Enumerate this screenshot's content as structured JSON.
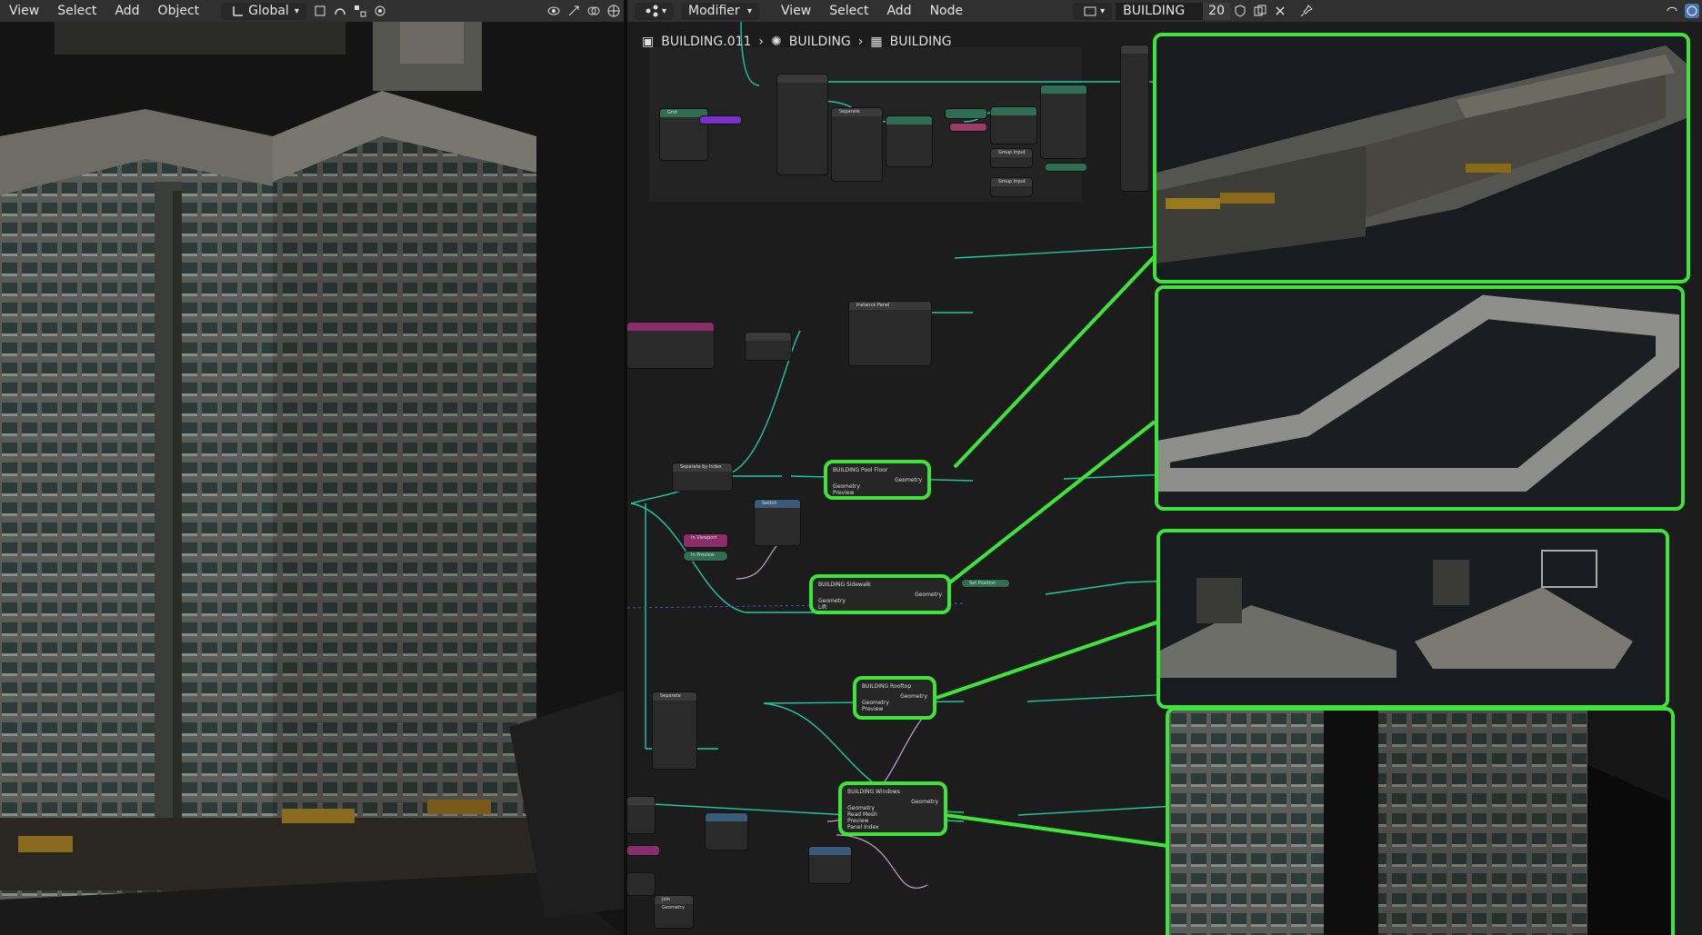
{
  "viewport_header": {
    "menu": [
      "View",
      "Select",
      "Add",
      "Object"
    ],
    "transform_orientation": "Global"
  },
  "node_header": {
    "editor_type": "Modifier",
    "menu": [
      "View",
      "Select",
      "Add",
      "Node"
    ],
    "datablock_name": "BUILDING",
    "user_count": "20"
  },
  "breadcrumb": {
    "object": "BUILDING.011",
    "modifier": "BUILDING",
    "node_group": "BUILDING"
  },
  "highlighted_nodes": [
    {
      "title": "BUILDING Pool Floor",
      "output": "Geometry",
      "inputs": [
        "Geometry",
        "Preview"
      ]
    },
    {
      "title": "BUILDING Sidewalk",
      "output": "Geometry",
      "inputs": [
        "Geometry",
        "Lift"
      ]
    },
    {
      "title": "BUILDING Rooftop",
      "output": "Geometry",
      "inputs": [
        "Geometry",
        "Preview"
      ]
    },
    {
      "title": "BUILDING Windows",
      "output": "Geometry",
      "inputs": [
        "Geometry",
        "Read Mesh",
        "Preview",
        "Panel Index"
      ]
    }
  ],
  "small_nodes": {
    "grid": "Grid",
    "separate": "Separate",
    "instance_panel": "Instance Panel",
    "separate_by_index": "Separate by Index",
    "switch": "Switch",
    "in_viewport": "In Viewport",
    "in_preview": "In Preview",
    "set_position": "Set Position",
    "group_input": "Group Input",
    "separate_2": "Separate",
    "join_geometry": "Join Geometry"
  },
  "colors": {
    "highlight": "#3ee43a",
    "link": "#1fc9a0",
    "link_pink": "#c9a0dc"
  }
}
